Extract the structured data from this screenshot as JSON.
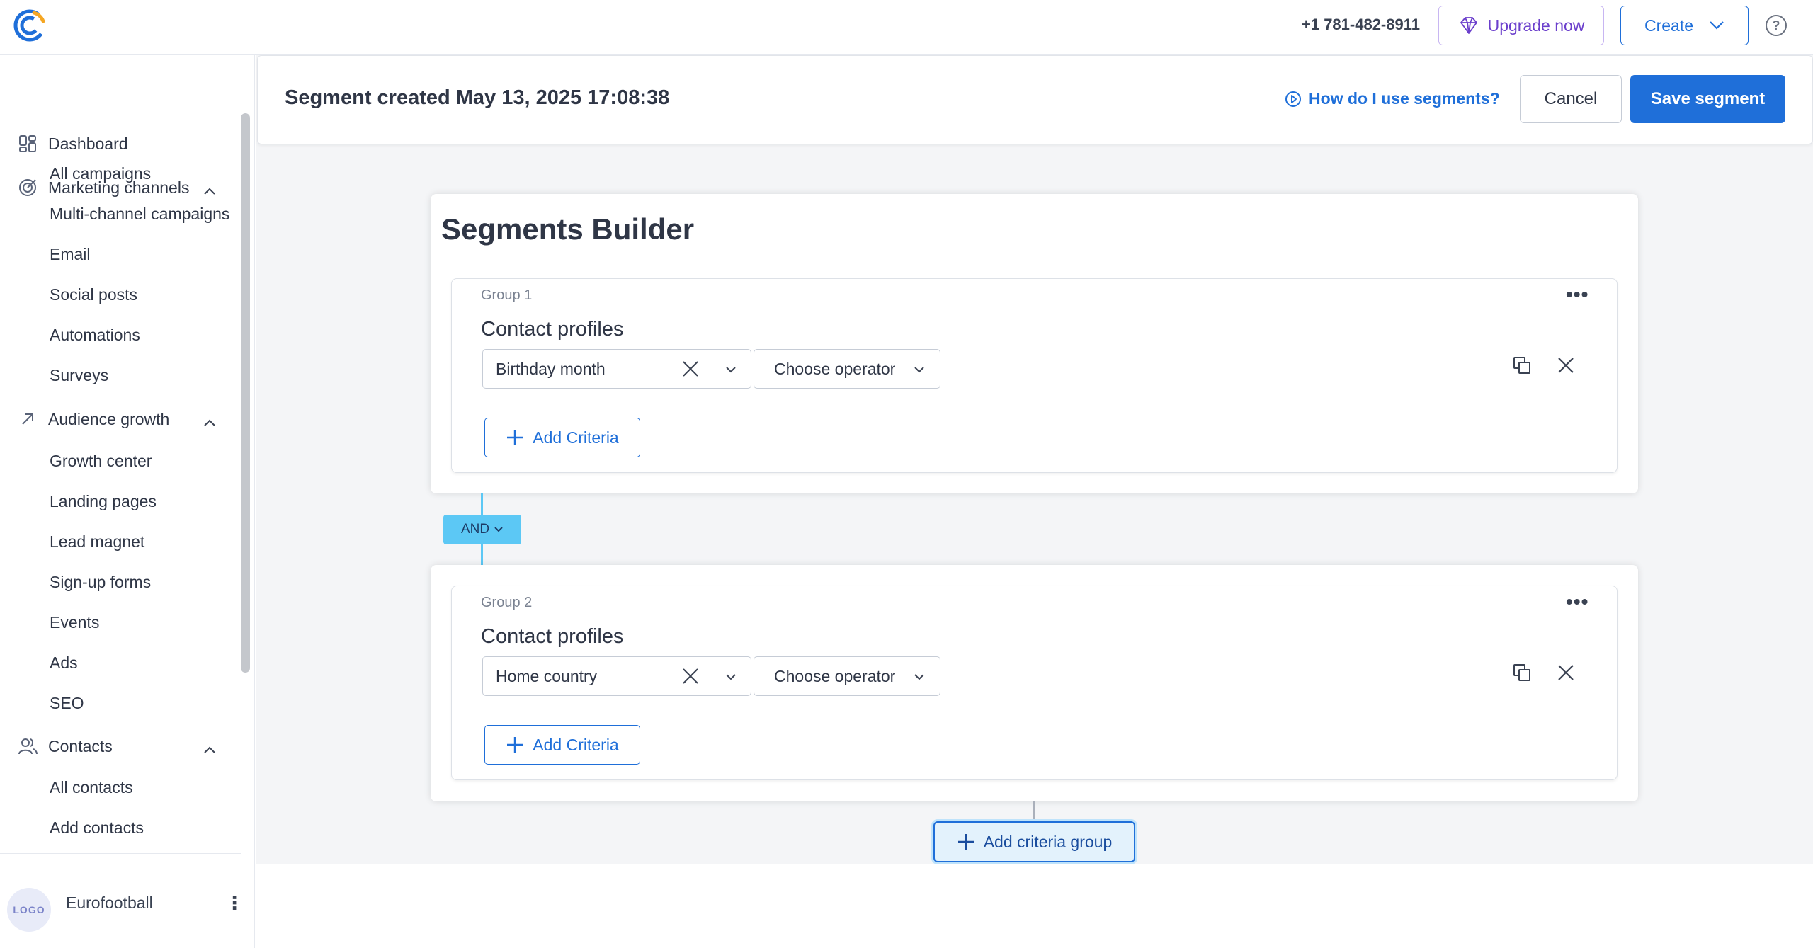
{
  "topbar": {
    "phone": "+1 781-482-8911",
    "upgrade_label": "Upgrade now",
    "create_label": "Create",
    "help_glyph": "?"
  },
  "sidebar": {
    "sections": [
      {
        "label": "Dashboard",
        "icon": "dashboard-icon"
      },
      {
        "label": "Marketing channels",
        "icon": "target-icon",
        "items": [
          "All campaigns",
          "Multi-channel campaigns",
          "Email",
          "Social posts",
          "Automations",
          "Surveys"
        ]
      },
      {
        "label": "Audience growth",
        "icon": "arrow-up-right-icon",
        "items": [
          "Growth center",
          "Landing pages",
          "Lead magnet",
          "Sign-up forms",
          "Events",
          "Ads",
          "SEO"
        ]
      },
      {
        "label": "Contacts",
        "icon": "contacts-icon",
        "items": [
          "All contacts",
          "Add contacts"
        ]
      }
    ],
    "footer": {
      "avatar_text": "LOGO",
      "org_name": "Eurofootball",
      "menu_glyph": "⋮"
    }
  },
  "header": {
    "title": "Segment created May 13, 2025 17:08:38",
    "help_link": "How do I use segments?",
    "cancel_label": "Cancel",
    "save_label": "Save segment"
  },
  "builder": {
    "title": "Segments Builder",
    "groups": [
      {
        "label": "Group 1",
        "heading": "Contact profiles",
        "field": "Birthday month",
        "operator_placeholder": "Choose operator",
        "add_label": "Add Criteria"
      },
      {
        "label": "Group 2",
        "heading": "Contact profiles",
        "field": "Home country",
        "operator_placeholder": "Choose operator",
        "add_label": "Add Criteria"
      }
    ],
    "connector_label": "AND",
    "add_group_label": "Add criteria group",
    "menu_glyph": "•••"
  },
  "colors": {
    "accent": "#1f6fd9",
    "connector": "#5cc8f5",
    "upgrade": "#6b3fcc"
  }
}
